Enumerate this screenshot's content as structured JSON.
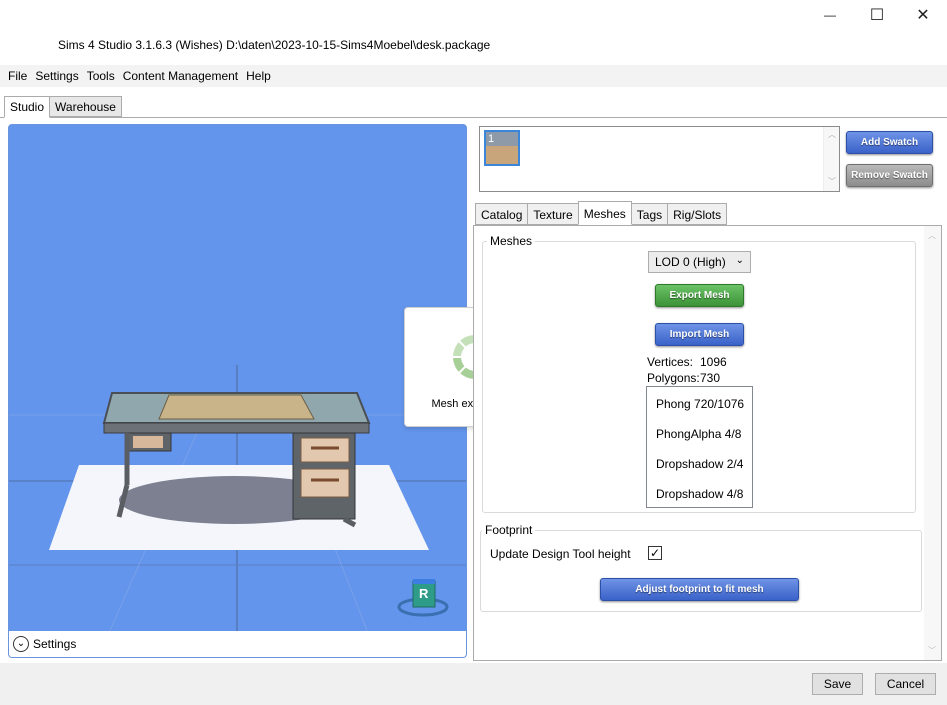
{
  "window": {
    "title": "Sims 4 Studio 3.1.6.3 (Wishes)  D:\\daten\\2023-10-15-Sims4Moebel\\desk.package",
    "minimize_glyph": "—",
    "maximize_glyph": "☐",
    "close_glyph": "✕"
  },
  "menu": [
    "File",
    "Settings",
    "Tools",
    "Content Management",
    "Help"
  ],
  "outer_tabs": [
    "Studio",
    "Warehouse"
  ],
  "viewport": {
    "settings_label": "Settings",
    "gizmo_label": "R",
    "background": "#6495ed"
  },
  "toast": {
    "message": "Mesh exportiert..."
  },
  "swatches": {
    "items": [
      {
        "label": "1"
      }
    ],
    "add_label": "Add Swatch",
    "remove_label": "Remove Swatch"
  },
  "inner_tabs": [
    "Catalog",
    "Texture",
    "Meshes",
    "Tags",
    "Rig/Slots"
  ],
  "meshes": {
    "group_label": "Meshes",
    "lod_selected": "LOD 0 (High)",
    "export_label": "Export Mesh",
    "import_label": "Import Mesh",
    "vertices_label": "Vertices:",
    "vertices_value": "1096",
    "polygons_label": "Polygons:",
    "polygons_value": "730",
    "mesh_list": [
      "Phong 720/1076",
      "PhongAlpha 4/8",
      "Dropshadow 2/4",
      "Dropshadow 4/8"
    ]
  },
  "footprint": {
    "group_label": "Footprint",
    "update_label": "Update Design Tool height",
    "update_checked": true,
    "adjust_label": "Adjust footprint to fit mesh"
  },
  "footer": {
    "save_label": "Save",
    "cancel_label": "Cancel"
  },
  "colors": {
    "accent_blue": "#3a62c9",
    "export_green": "#3c9236"
  }
}
